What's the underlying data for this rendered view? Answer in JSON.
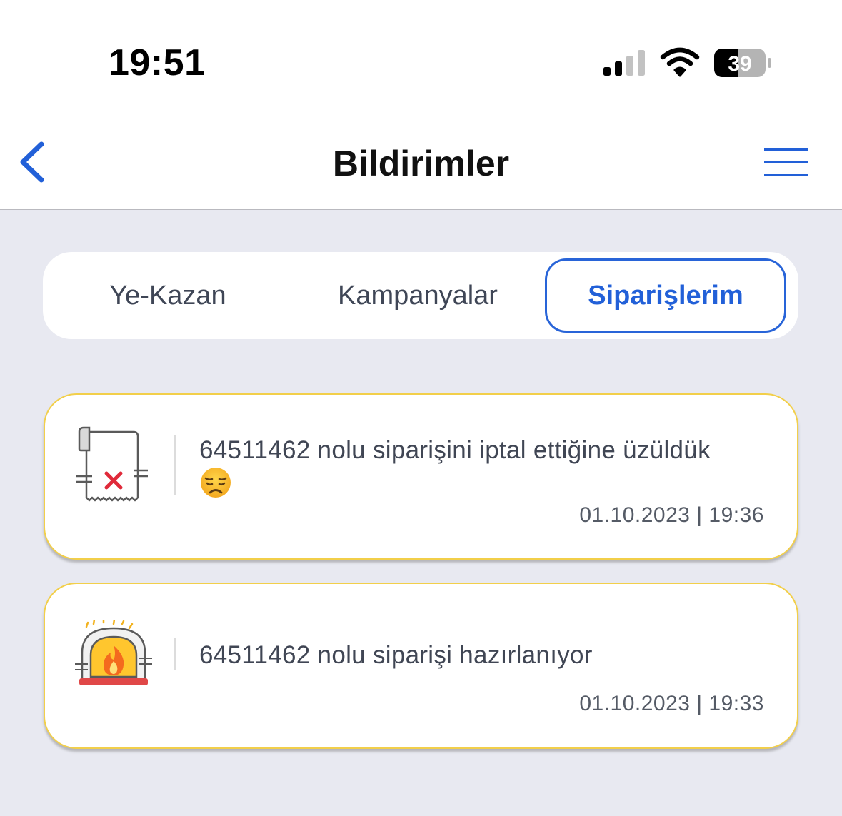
{
  "status_bar": {
    "time": "19:51",
    "battery": "39",
    "icons": [
      "signal-icon",
      "wifi-icon",
      "battery-icon"
    ]
  },
  "nav": {
    "title": "Bildirimler",
    "back_icon": "chevron-left-icon",
    "menu_icon": "menu-icon"
  },
  "tabs": [
    {
      "label": "Ye-Kazan",
      "selected": false
    },
    {
      "label": "Kampanyalar",
      "selected": false
    },
    {
      "label": "Siparişlerim",
      "selected": true
    }
  ],
  "notifications": [
    {
      "icon": "cancelled-receipt-icon",
      "message": "64511462 nolu siparişini iptal ettiğine üzüldük",
      "emoji": "disappointed-face-icon",
      "date": "01.10.2023 | 19:36"
    },
    {
      "icon": "oven-icon",
      "message": "64511462 nolu siparişi hazırlanıyor",
      "date": "01.10.2023 | 19:33"
    }
  ],
  "colors": {
    "accent": "#2260d8",
    "card_border": "#f2cf4a",
    "background": "#e8e9f1"
  }
}
